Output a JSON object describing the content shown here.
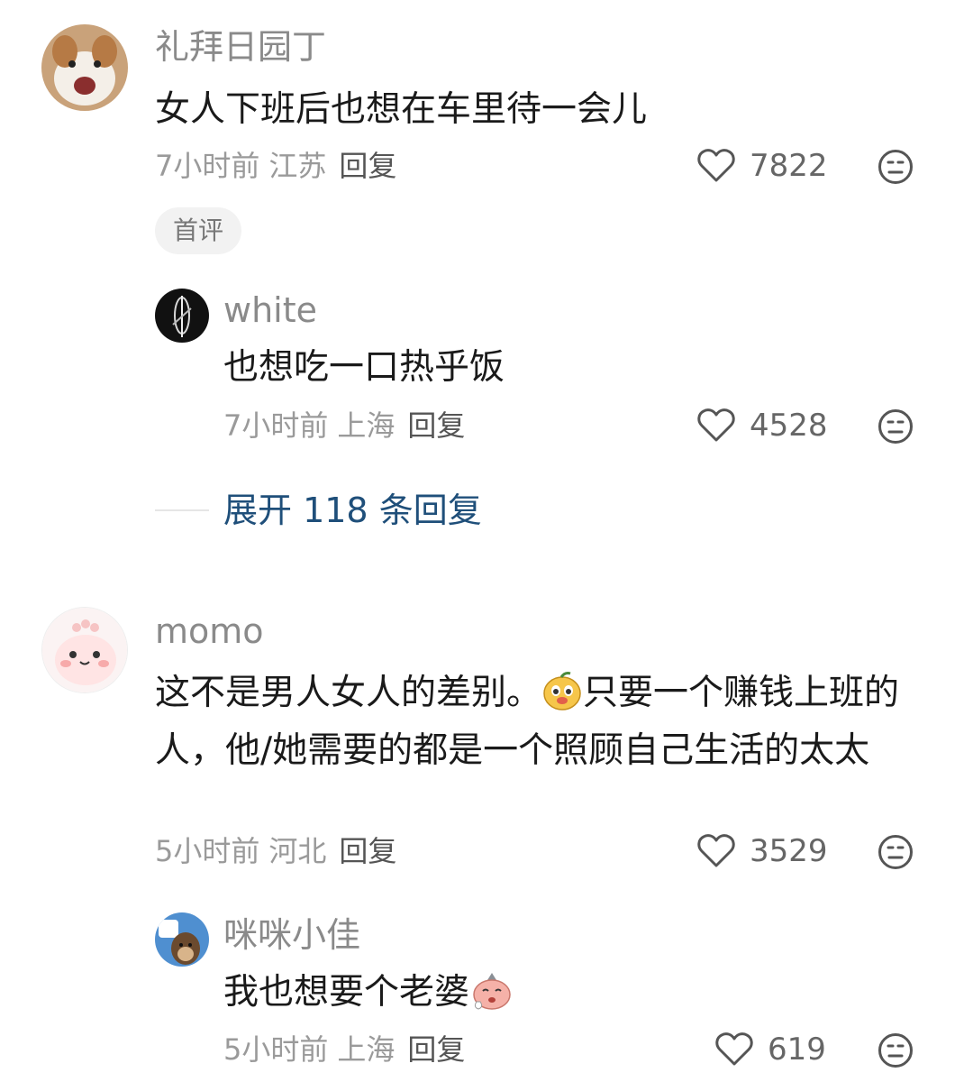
{
  "comments": [
    {
      "username": "礼拜日园丁",
      "text": "女人下班后也想在车里待一会儿",
      "time": "7小时前",
      "location": "江苏",
      "reply_label": "回复",
      "likes": "7822",
      "tag": "首评",
      "replies": [
        {
          "username": "white",
          "text": "也想吃一口热乎饭",
          "time": "7小时前",
          "location": "上海",
          "reply_label": "回复",
          "likes": "4528"
        }
      ],
      "expand_label": "展开 118 条回复"
    },
    {
      "username": "momo",
      "text_part1": "这不是男人女人的差别。",
      "text_part2": "只要一个赚钱上班的人，他/她需要的都是一个照顾自己生活的太太",
      "time": "5小时前",
      "location": "河北",
      "reply_label": "回复",
      "likes": "3529",
      "replies": [
        {
          "username": "咪咪小佳",
          "text": "我也想要个老婆",
          "time": "5小时前",
          "location": "上海",
          "reply_label": "回复",
          "likes": "619"
        }
      ]
    }
  ],
  "icons": {
    "like": "heart-outline-icon",
    "emoji": "neutral-face-icon"
  },
  "colors": {
    "expand_link": "#1f4f7a",
    "username": "#8a8a8a",
    "meta": "#9a9a9a"
  }
}
